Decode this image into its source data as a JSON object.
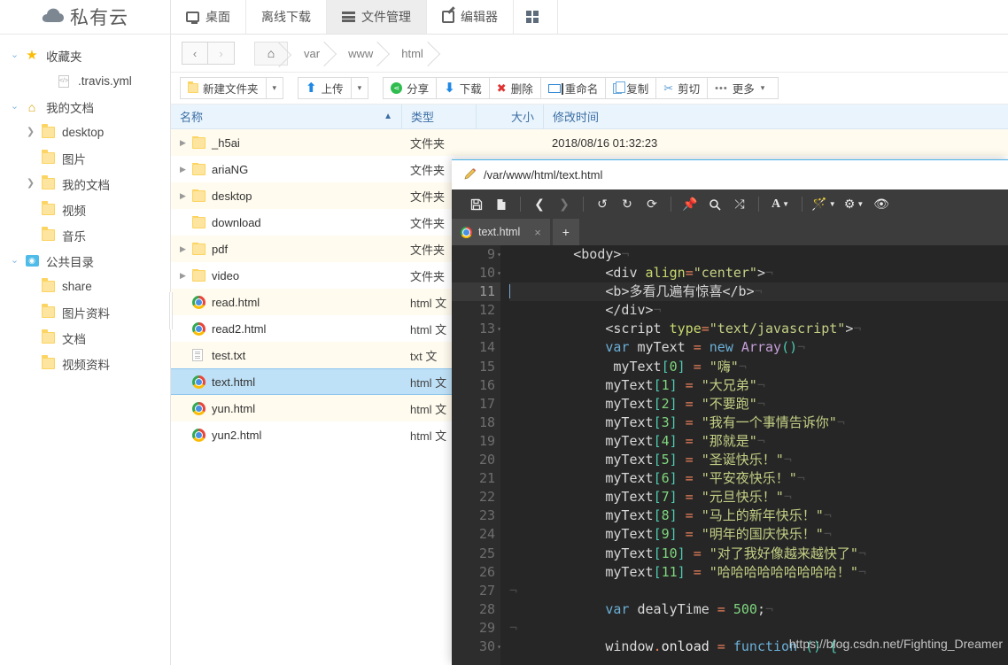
{
  "brand": {
    "name": "私有云",
    "icon": "cloud-icon"
  },
  "sidebar": {
    "items": [
      {
        "label": "收藏夹",
        "icon": "star-icon",
        "twisty": "down",
        "indent": 0
      },
      {
        "label": ".travis.yml",
        "icon": "code-file-icon",
        "twisty": "",
        "indent": 2
      },
      {
        "label": "我的文档",
        "icon": "home-icon",
        "twisty": "down",
        "indent": 0
      },
      {
        "label": "desktop",
        "icon": "folder-icon",
        "twisty": "right",
        "indent": 1
      },
      {
        "label": "图片",
        "icon": "folder-icon",
        "twisty": "",
        "indent": 1
      },
      {
        "label": "我的文档",
        "icon": "folder-icon",
        "twisty": "right",
        "indent": 1
      },
      {
        "label": "视频",
        "icon": "folder-icon",
        "twisty": "",
        "indent": 1
      },
      {
        "label": "音乐",
        "icon": "folder-icon",
        "twisty": "",
        "indent": 1
      },
      {
        "label": "公共目录",
        "icon": "public-icon",
        "twisty": "down",
        "indent": 0
      },
      {
        "label": "share",
        "icon": "folder-icon",
        "twisty": "",
        "indent": 1
      },
      {
        "label": "图片资料",
        "icon": "folder-icon",
        "twisty": "",
        "indent": 1
      },
      {
        "label": "文档",
        "icon": "folder-icon",
        "twisty": "",
        "indent": 1
      },
      {
        "label": "视频资料",
        "icon": "folder-icon",
        "twisty": "",
        "indent": 1
      }
    ]
  },
  "topnav": {
    "tabs": [
      {
        "label": "桌面",
        "icon": "monitor-icon",
        "active": false
      },
      {
        "label": "离线下载",
        "icon": "",
        "active": false
      },
      {
        "label": "文件管理",
        "icon": "list-icon",
        "active": true
      },
      {
        "label": "编辑器",
        "icon": "edit-icon",
        "active": false
      },
      {
        "label": "",
        "icon": "grid-icon",
        "active": false
      }
    ]
  },
  "breadcrumb": {
    "back": "‹",
    "forward": "›",
    "home_icon": "home-icon",
    "path": [
      "var",
      "www",
      "html"
    ]
  },
  "toolbar": {
    "new_folder": "新建文件夹",
    "upload": "上传",
    "share": "分享",
    "download": "下载",
    "delete": "删除",
    "rename": "重命名",
    "copy": "复制",
    "cut": "剪切",
    "more": "更多",
    "caret": "▾"
  },
  "filelist": {
    "columns": {
      "name": "名称",
      "type": "类型",
      "size": "大小",
      "time": "修改时间"
    },
    "sort_indicator": "▲",
    "rows": [
      {
        "name": "_h5ai",
        "type": "文件夹",
        "size": "",
        "time": "2018/08/16 01:32:23",
        "icon": "folder-icon",
        "expandable": true,
        "selected": false
      },
      {
        "name": "ariaNG",
        "type": "文件夹",
        "size": "",
        "time": "",
        "icon": "folder-icon",
        "expandable": true,
        "selected": false
      },
      {
        "name": "desktop",
        "type": "文件夹",
        "size": "",
        "time": "",
        "icon": "folder-icon",
        "expandable": true,
        "selected": false
      },
      {
        "name": "download",
        "type": "文件夹",
        "size": "",
        "time": "",
        "icon": "folder-icon",
        "expandable": false,
        "selected": false
      },
      {
        "name": "pdf",
        "type": "文件夹",
        "size": "",
        "time": "",
        "icon": "folder-icon",
        "expandable": true,
        "selected": false
      },
      {
        "name": "video",
        "type": "文件夹",
        "size": "",
        "time": "",
        "icon": "folder-icon",
        "expandable": true,
        "selected": false
      },
      {
        "name": "read.html",
        "type": "html 文",
        "size": "",
        "time": "",
        "icon": "chrome-icon",
        "expandable": false,
        "selected": false
      },
      {
        "name": "read2.html",
        "type": "html 文",
        "size": "",
        "time": "",
        "icon": "chrome-icon",
        "expandable": false,
        "selected": false
      },
      {
        "name": "test.txt",
        "type": "txt 文",
        "size": "",
        "time": "",
        "icon": "txt-icon",
        "expandable": false,
        "selected": false
      },
      {
        "name": "text.html",
        "type": "html 文",
        "size": "",
        "time": "",
        "icon": "chrome-icon",
        "expandable": false,
        "selected": true
      },
      {
        "name": "yun.html",
        "type": "html 文",
        "size": "",
        "time": "",
        "icon": "chrome-icon",
        "expandable": false,
        "selected": false
      },
      {
        "name": "yun2.html",
        "type": "html 文",
        "size": "",
        "time": "",
        "icon": "chrome-icon",
        "expandable": false,
        "selected": false
      }
    ]
  },
  "editor": {
    "title_path": "/var/www/html/text.html",
    "title_icon": "pencil-icon",
    "toolbar_icons": [
      "save-icon",
      "save-as-icon",
      "sep",
      "back-icon",
      "forward-icon",
      "sep",
      "undo-icon",
      "redo-icon",
      "reload-icon",
      "sep",
      "pin-icon",
      "search-icon",
      "shuffle-icon",
      "sep",
      "font-icon",
      "sep",
      "wand-icon",
      "gear-icon",
      "eye-icon"
    ],
    "tab": {
      "label": "text.html",
      "icon": "chrome-icon",
      "close": "×"
    },
    "add_tab": "+",
    "current_line": 11,
    "lines": [
      {
        "n": 9,
        "fold": "▾",
        "code": "        <body>"
      },
      {
        "n": 10,
        "fold": "▾",
        "code": "            <div align=\"center\">"
      },
      {
        "n": 11,
        "fold": "",
        "code": "            <b>多看几遍有惊喜</b>"
      },
      {
        "n": 12,
        "fold": "",
        "code": "            </div>"
      },
      {
        "n": 13,
        "fold": "▾",
        "code": "            <script type=\"text/javascript\">"
      },
      {
        "n": 14,
        "fold": "",
        "code": "            var myText = new Array()"
      },
      {
        "n": 15,
        "fold": "",
        "code": "             myText[0] = \"嗨\""
      },
      {
        "n": 16,
        "fold": "",
        "code": "            myText[1] = \"大兄弟\""
      },
      {
        "n": 17,
        "fold": "",
        "code": "            myText[2] = \"不要跑\""
      },
      {
        "n": 18,
        "fold": "",
        "code": "            myText[3] = \"我有一个事情告诉你\""
      },
      {
        "n": 19,
        "fold": "",
        "code": "            myText[4] = \"那就是\""
      },
      {
        "n": 20,
        "fold": "",
        "code": "            myText[5] = \"圣诞快乐！\""
      },
      {
        "n": 21,
        "fold": "",
        "code": "            myText[6] = \"平安夜快乐！\""
      },
      {
        "n": 22,
        "fold": "",
        "code": "            myText[7] = \"元旦快乐！\""
      },
      {
        "n": 23,
        "fold": "",
        "code": "            myText[8] = \"马上的新年快乐！\""
      },
      {
        "n": 24,
        "fold": "",
        "code": "            myText[9] = \"明年的国庆快乐！\""
      },
      {
        "n": 25,
        "fold": "",
        "code": "            myText[10] = \"对了我好像越来越快了\""
      },
      {
        "n": 26,
        "fold": "",
        "code": "            myText[11] = \"哈哈哈哈哈哈哈哈哈！\""
      },
      {
        "n": 27,
        "fold": "",
        "code": ""
      },
      {
        "n": 28,
        "fold": "",
        "code": "            var dealyTime = 500;"
      },
      {
        "n": 29,
        "fold": "",
        "code": ""
      },
      {
        "n": 30,
        "fold": "▾",
        "code": "            window.onload = function () {"
      }
    ],
    "watermark": "https://blog.csdn.net/Fighting_Dreamer"
  },
  "colors": {
    "accent": "#4ab3e8",
    "selection": "#bfe1f7",
    "header": "#eaf4fc",
    "folder": "#fcd462",
    "editor_bg": "#262626"
  }
}
